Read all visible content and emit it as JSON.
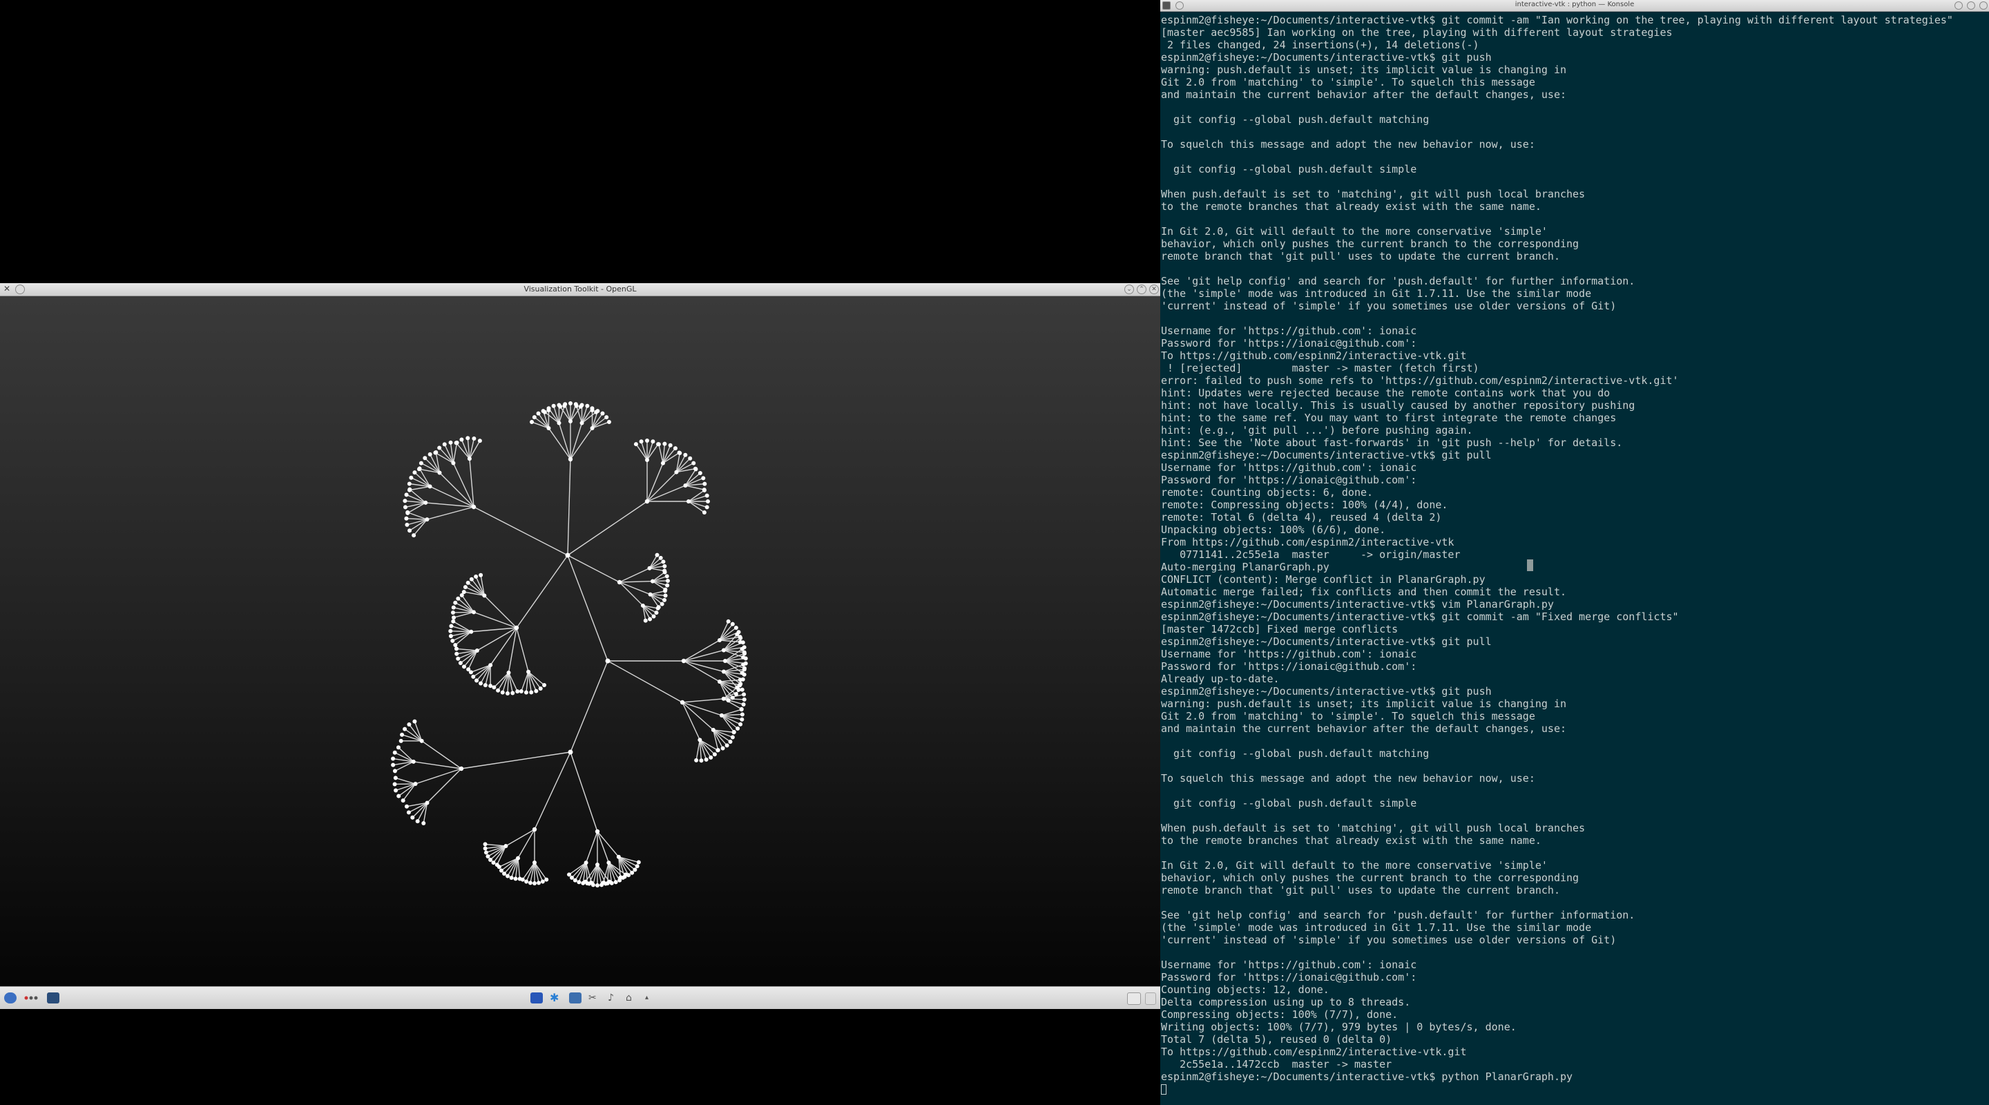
{
  "vtk_window": {
    "title": "Visualization Toolkit - OpenGL"
  },
  "terminal": {
    "title": "interactive-vtk : python — Konsole",
    "lines": [
      "espinm2@fisheye:~/Documents/interactive-vtk$ git commit -am \"Ian working on the tree, playing with different layout strategies\"",
      "[master aec9585] Ian working on the tree, playing with different layout strategies",
      " 2 files changed, 24 insertions(+), 14 deletions(-)",
      "espinm2@fisheye:~/Documents/interactive-vtk$ git push",
      "warning: push.default is unset; its implicit value is changing in",
      "Git 2.0 from 'matching' to 'simple'. To squelch this message",
      "and maintain the current behavior after the default changes, use:",
      "",
      "  git config --global push.default matching",
      "",
      "To squelch this message and adopt the new behavior now, use:",
      "",
      "  git config --global push.default simple",
      "",
      "When push.default is set to 'matching', git will push local branches",
      "to the remote branches that already exist with the same name.",
      "",
      "In Git 2.0, Git will default to the more conservative 'simple'",
      "behavior, which only pushes the current branch to the corresponding",
      "remote branch that 'git pull' uses to update the current branch.",
      "",
      "See 'git help config' and search for 'push.default' for further information.",
      "(the 'simple' mode was introduced in Git 1.7.11. Use the similar mode",
      "'current' instead of 'simple' if you sometimes use older versions of Git)",
      "",
      "Username for 'https://github.com': ionaic",
      "Password for 'https://ionaic@github.com':",
      "To https://github.com/espinm2/interactive-vtk.git",
      " ! [rejected]        master -> master (fetch first)",
      "error: failed to push some refs to 'https://github.com/espinm2/interactive-vtk.git'",
      "hint: Updates were rejected because the remote contains work that you do",
      "hint: not have locally. This is usually caused by another repository pushing",
      "hint: to the same ref. You may want to first integrate the remote changes",
      "hint: (e.g., 'git pull ...') before pushing again.",
      "hint: See the 'Note about fast-forwards' in 'git push --help' for details.",
      "espinm2@fisheye:~/Documents/interactive-vtk$ git pull",
      "Username for 'https://github.com': ionaic",
      "Password for 'https://ionaic@github.com':",
      "remote: Counting objects: 6, done.",
      "remote: Compressing objects: 100% (4/4), done.",
      "remote: Total 6 (delta 4), reused 4 (delta 2)",
      "Unpacking objects: 100% (6/6), done.",
      "From https://github.com/espinm2/interactive-vtk",
      "   0771141..2c55e1a  master     -> origin/master",
      "Auto-merging PlanarGraph.py",
      "CONFLICT (content): Merge conflict in PlanarGraph.py",
      "Automatic merge failed; fix conflicts and then commit the result.",
      "espinm2@fisheye:~/Documents/interactive-vtk$ vim PlanarGraph.py",
      "espinm2@fisheye:~/Documents/interactive-vtk$ git commit -am \"Fixed merge conflicts\"",
      "[master 1472ccb] Fixed merge conflicts",
      "espinm2@fisheye:~/Documents/interactive-vtk$ git pull",
      "Username for 'https://github.com': ionaic",
      "Password for 'https://ionaic@github.com':",
      "Already up-to-date.",
      "espinm2@fisheye:~/Documents/interactive-vtk$ git push",
      "warning: push.default is unset; its implicit value is changing in",
      "Git 2.0 from 'matching' to 'simple'. To squelch this message",
      "and maintain the current behavior after the default changes, use:",
      "",
      "  git config --global push.default matching",
      "",
      "To squelch this message and adopt the new behavior now, use:",
      "",
      "  git config --global push.default simple",
      "",
      "When push.default is set to 'matching', git will push local branches",
      "to the remote branches that already exist with the same name.",
      "",
      "In Git 2.0, Git will default to the more conservative 'simple'",
      "behavior, which only pushes the current branch to the corresponding",
      "remote branch that 'git pull' uses to update the current branch.",
      "",
      "See 'git help config' and search for 'push.default' for further information.",
      "(the 'simple' mode was introduced in Git 1.7.11. Use the similar mode",
      "'current' instead of 'simple' if you sometimes use older versions of Git)",
      "",
      "Username for 'https://github.com': ionaic",
      "Password for 'https://ionaic@github.com':",
      "Counting objects: 12, done.",
      "Delta compression using up to 8 threads.",
      "Compressing objects: 100% (7/7), done.",
      "Writing objects: 100% (7/7), 979 bytes | 0 bytes/s, done.",
      "Total 7 (delta 5), reused 0 (delta 0)",
      "To https://github.com/espinm2/interactive-vtk.git",
      "   2c55e1a..1472ccb  master -> master",
      "espinm2@fisheye:~/Documents/interactive-vtk$ python PlanarGraph.py"
    ]
  }
}
